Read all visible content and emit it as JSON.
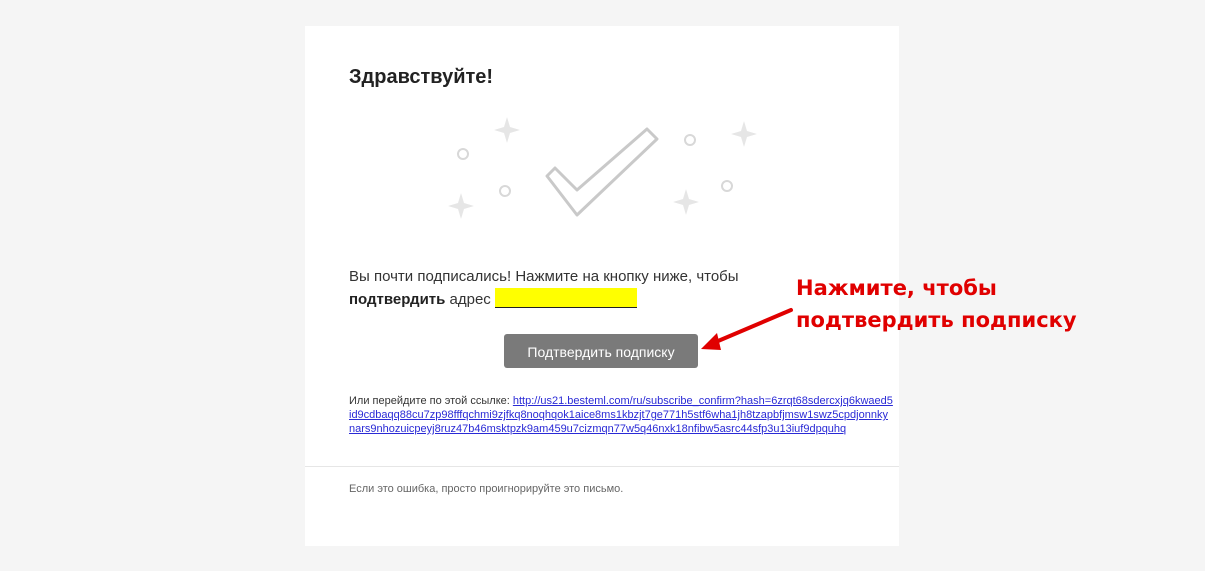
{
  "email": {
    "greeting": "Здравствуйте!",
    "message_prefix": "Вы почти подписались! Нажмите на кнопку ниже, чтобы",
    "message_bold": "подтвердить",
    "message_suffix": "адрес",
    "email_value": "",
    "confirm_button_label": "Подтвердить подписку",
    "alt_link_prefix": "Или перейдите по этой ссылке:",
    "alt_link_url": "http://us21.besteml.com/ru/subscribe_confirm?hash=6zrqt68sdercxjq6kwaed5id9cdbaqq88cu7zp98fffqchmi9zjfkq8noqhqok1aice8ms1kbzjt7ge771h5stf6wha1jh8tzapbfjmsw1swz5cpdjonnkynars9nhozuicpeyj8ruz47b46msktpzk9am459u7cizmqn77w5q46nxk18nfibw5asrc44sfp3u13iuf9dpquhq",
    "footer_note": "Если это ошибка, просто проигнорируйте это письмо."
  },
  "annotation": {
    "text": "Нажмите, чтобы подтвердить подписку",
    "color": "#e00000"
  },
  "colors": {
    "background": "#f5f5f5",
    "card": "#ffffff",
    "button": "#7a7a7a",
    "email_highlight": "#ffff00",
    "link": "#2a2ad6"
  },
  "icons": {
    "hero": "checkmark-icon",
    "decorations": [
      "sparkle-icon",
      "circle-icon"
    ]
  }
}
